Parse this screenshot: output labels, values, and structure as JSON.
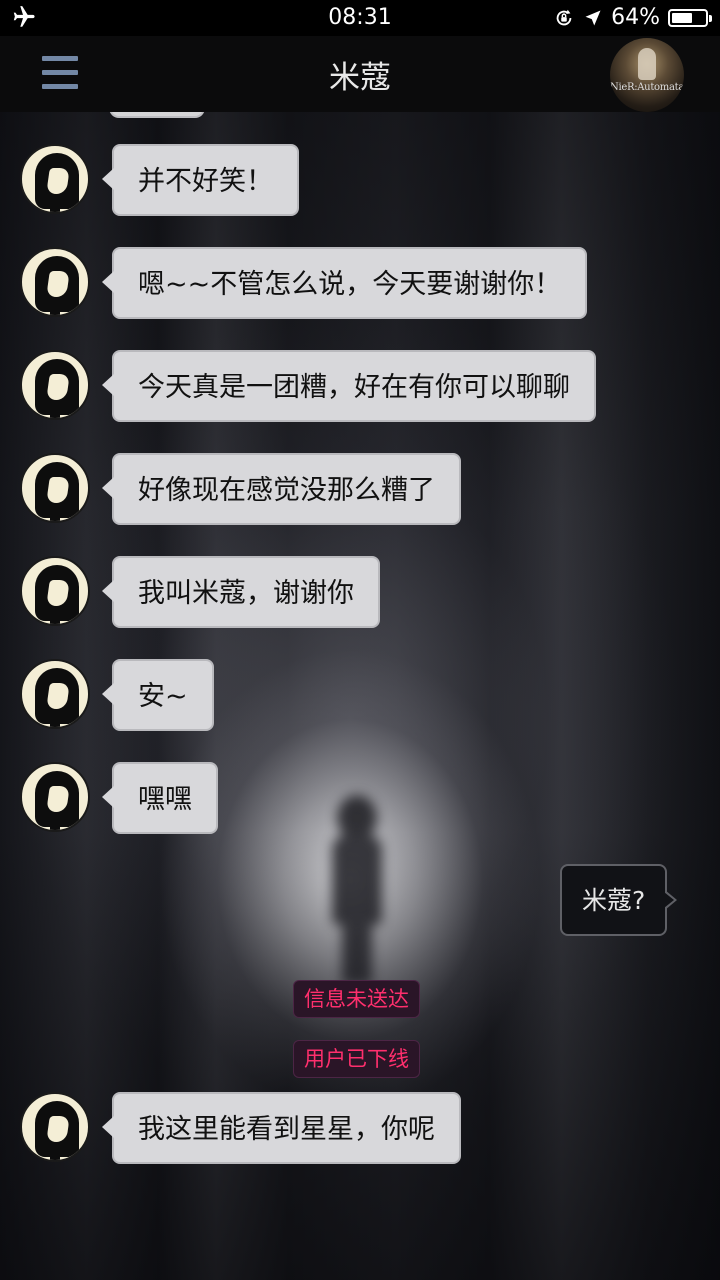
{
  "status_bar": {
    "time": "08:31",
    "battery": "64%",
    "battery_level": 0.64
  },
  "nav": {
    "title": "米蔻",
    "avatar_caption": "NieR:Automata"
  },
  "messages": [
    {
      "text": "并不好笑！"
    },
    {
      "text": "嗯~~不管怎么说，今天要谢谢你！"
    },
    {
      "text": "今天真是一团糟，好在有你可以聊聊"
    },
    {
      "text": "好像现在感觉没那么糟了"
    },
    {
      "text": "我叫米蔻，谢谢你"
    },
    {
      "text": "安~"
    },
    {
      "text": "嘿嘿"
    }
  ],
  "outgoing": {
    "text": "米蔻?"
  },
  "system_notices": [
    "信息未送达",
    "用户已下线"
  ],
  "last_message": {
    "text": "我这里能看到星星，你呢"
  },
  "colors": {
    "incoming_bubble": "#d8d8db",
    "outgoing_bubble": "#111216",
    "system_text": "#ff2f6d",
    "menu_icon": "#7388a6"
  },
  "icons": [
    "airplane-mode-icon",
    "rotation-lock-icon",
    "location-arrow-icon",
    "battery-icon",
    "menu-icon"
  ]
}
